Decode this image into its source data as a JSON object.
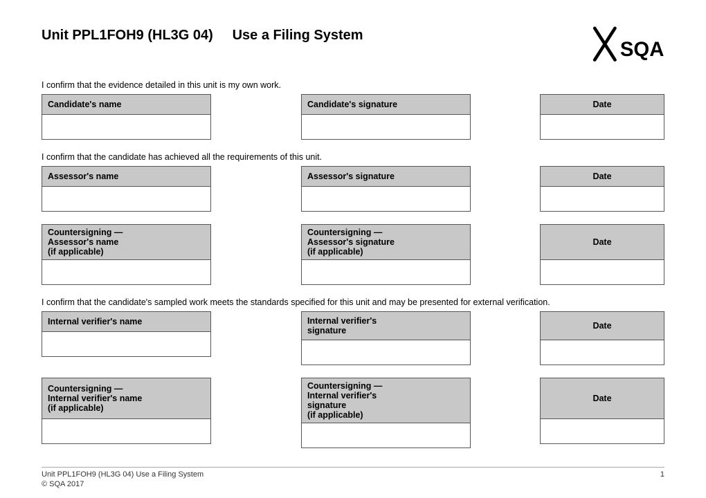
{
  "header": {
    "title_unit": "Unit PPL1FOH9 (HL3G 04)",
    "title_name": "Use a Filing System"
  },
  "sections": {
    "candidate_confirm": "I confirm that the evidence detailed in this unit is my own work.",
    "assessor_confirm": "I confirm that the candidate has achieved all the requirements of this unit.",
    "verifier_confirm": "I confirm that the candidate's sampled work meets the standards specified for this unit and may be presented for external verification."
  },
  "labels": {
    "candidates_name": "Candidate's name",
    "candidates_signature": "Candidate's signature",
    "date": "Date",
    "assessors_name": "Assessor's name",
    "assessors_signature": "Assessor's signature",
    "countersigning_assessors_name": "Countersigning —\nAssessor's name\n(if applicable)",
    "countersigning_assessors_signature": "Countersigning —\nAssessor's signature\n(if applicable)",
    "internal_verifiers_name": "Internal verifier's name",
    "internal_verifiers_signature": "Internal verifier's\nsignature",
    "countersigning_verifiers_name": "Countersigning —\nInternal verifier's name\n(if applicable)",
    "countersigning_verifiers_signature": "Countersigning —\nInternal verifier's\nsignature\n(if applicable)"
  },
  "footer": {
    "unit_line": "Unit PPL1FOH9 (HL3G 04) Use a Filing System",
    "copyright": "© SQA 2017",
    "page": "1"
  }
}
